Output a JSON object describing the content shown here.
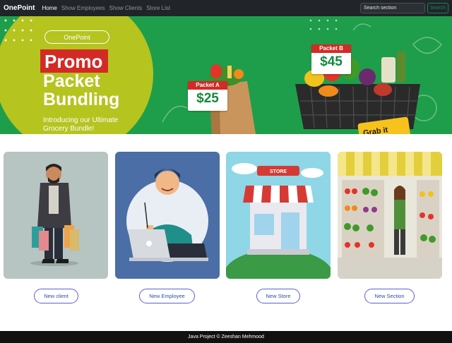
{
  "navbar": {
    "brand": "OnePoint",
    "links": [
      "Home",
      "Show Employees",
      "Show Clients",
      "Store List"
    ],
    "search_placeholder": "Search section",
    "search_button": "Search"
  },
  "banner": {
    "pill": "OnePoint",
    "promo": "Promo",
    "bundling_line1": "Packet",
    "bundling_line2": "Bundling",
    "intro_line1": "Introducing our Ultimate",
    "intro_line2": "Grocery Bundle!",
    "packet_a": {
      "label": "Packet A",
      "price": "$25"
    },
    "packet_b": {
      "label": "Packet B",
      "price": "$45"
    },
    "grab": "Grab it",
    "store_sign": "STORE"
  },
  "cards": [
    {
      "button": "New client"
    },
    {
      "button": "New Employee"
    },
    {
      "button": "New Store"
    },
    {
      "button": "New Section"
    }
  ],
  "footer": {
    "text": "Java Project © Zeeshan Mehmood"
  },
  "colors": {
    "navbar": "#212529",
    "banner_green": "#1e9e4a",
    "accent_red": "#d42a26",
    "button_border": "#5b5fd3",
    "footer": "#111111"
  }
}
